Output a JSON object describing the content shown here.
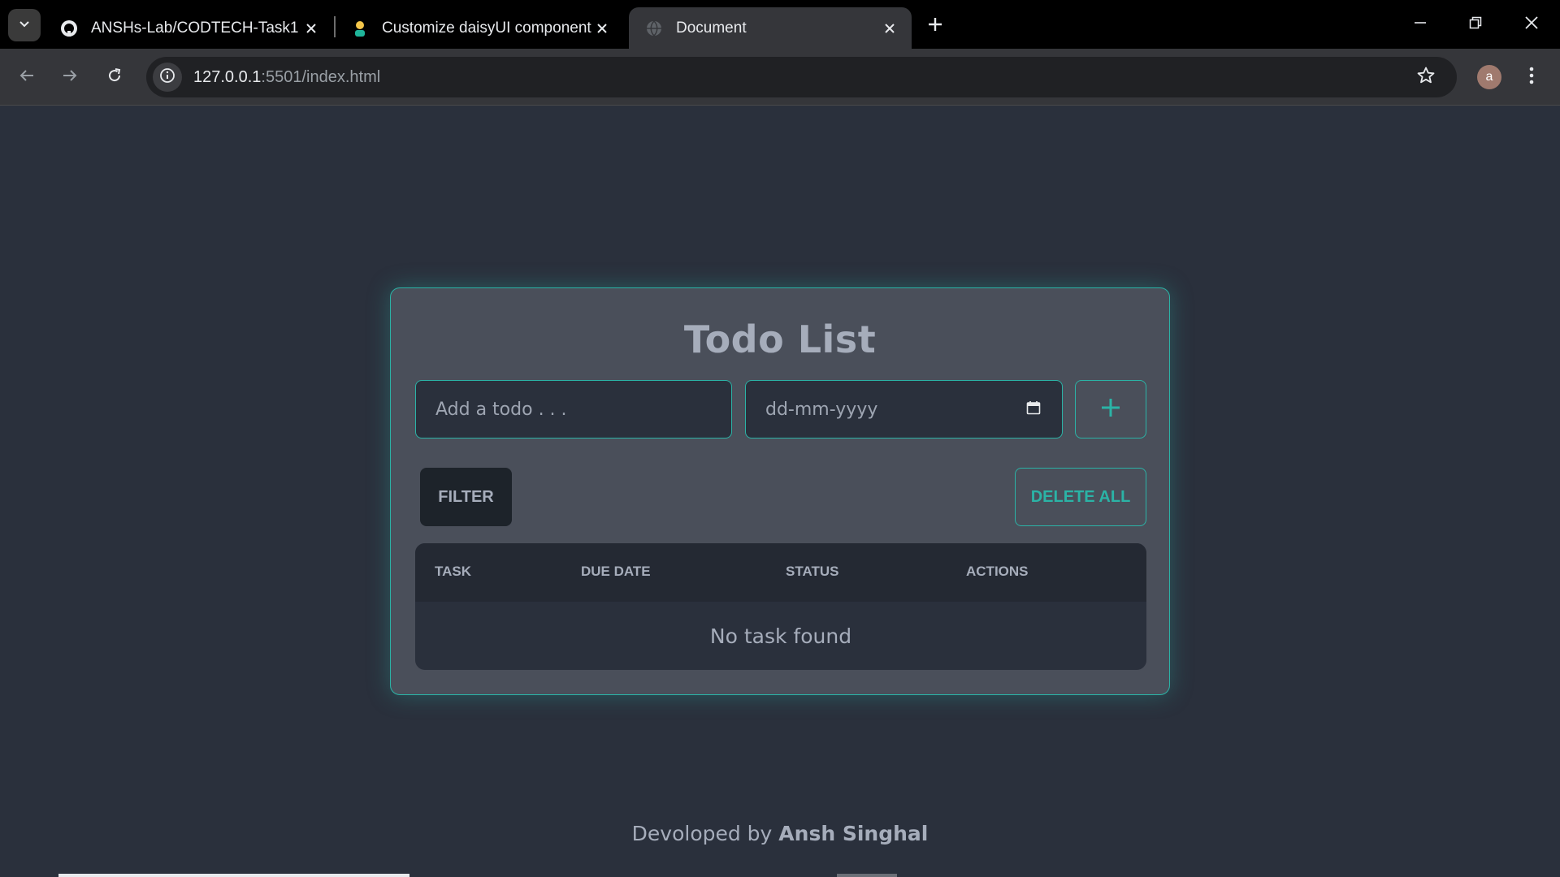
{
  "browser": {
    "tabs": [
      {
        "title": "ANSHs-Lab/CODTECH-Task1",
        "icon": "github-icon",
        "active": false
      },
      {
        "title": "Customize daisyUI components",
        "icon": "daisyui-icon",
        "active": false
      },
      {
        "title": "Document",
        "icon": "globe-icon",
        "active": true
      }
    ],
    "url_host": "127.0.0.1",
    "url_rest": ":5501/index.html",
    "profile_initial": "a"
  },
  "app": {
    "title": "Todo List",
    "todo_placeholder": "Add a todo . . .",
    "date_placeholder": "dd-mm-yyyy",
    "add_icon": "plus-icon",
    "filter_label": "FILTER",
    "delete_all_label": "DELETE ALL",
    "table": {
      "headers": [
        "TASK",
        "DUE DATE",
        "STATUS",
        "ACTIONS"
      ],
      "empty_message": "No task found"
    }
  },
  "footer": {
    "prefix": "Devoloped by ",
    "author": "Ansh Singhal"
  },
  "colors": {
    "accent": "#2bb3a6",
    "background": "#2a303c",
    "card": "#4a4f5a"
  }
}
